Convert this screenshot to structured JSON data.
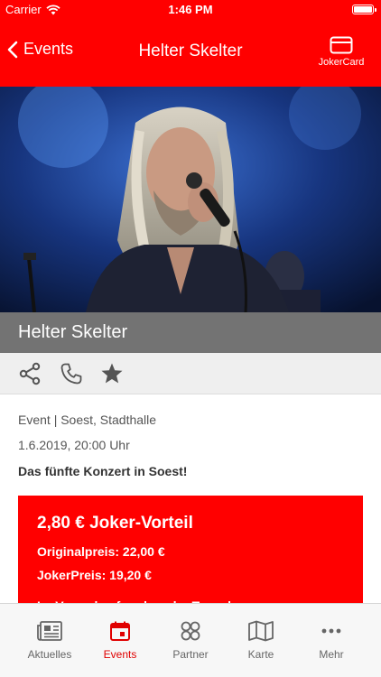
{
  "status_bar": {
    "carrier": "Carrier",
    "time": "1:46 PM"
  },
  "nav": {
    "back_label": "Events",
    "title": "Helter Skelter",
    "right_button_label": "JokerCard",
    "accent_color": "#ff0000"
  },
  "hero": {
    "image_subject": "singer-with-microphone-photo"
  },
  "event": {
    "title": "Helter Skelter",
    "category_location": "Event | Soest, Stadthalle",
    "datetime": "1.6.2019, 20:00 Uhr",
    "subtitle": "Das fünfte Konzert in Soest!"
  },
  "actions": [
    {
      "name": "share-icon"
    },
    {
      "name": "phone-icon"
    },
    {
      "name": "star-icon"
    }
  ],
  "promo": {
    "title": "2,80 € Joker-Vorteil",
    "original_price": "Originalpreis: 22,00 €",
    "joker_price": "JokerPreis: 19,20 €",
    "sales_info": "Im Vorverkauf und an der Tageskasse"
  },
  "tabs": [
    {
      "label": "Aktuelles",
      "icon": "newspaper-icon",
      "active": false
    },
    {
      "label": "Events",
      "icon": "calendar-icon",
      "active": true
    },
    {
      "label": "Partner",
      "icon": "partner-icon",
      "active": false
    },
    {
      "label": "Karte",
      "icon": "map-icon",
      "active": false
    },
    {
      "label": "Mehr",
      "icon": "more-icon",
      "active": false
    }
  ]
}
